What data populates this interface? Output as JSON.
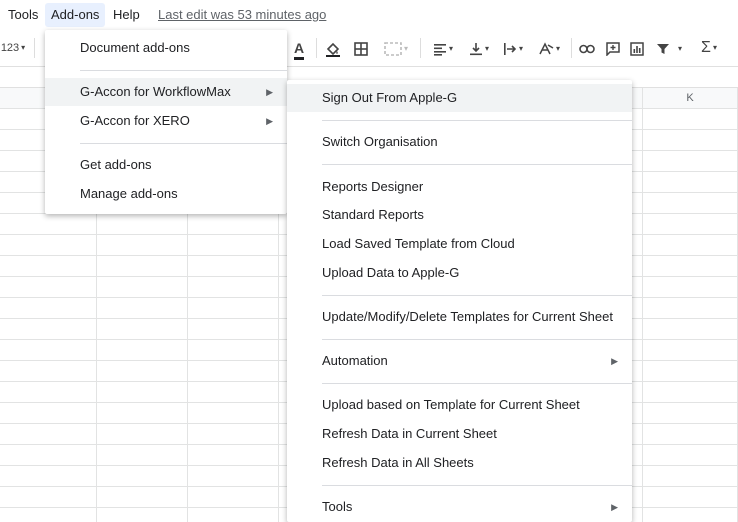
{
  "menubar": {
    "tools": "Tools",
    "addons": "Add-ons",
    "help": "Help",
    "last_edit": "Last edit was 53 minutes ago"
  },
  "toolbar": {
    "format_number": "123",
    "text_color_glyph": "A"
  },
  "columns": {
    "k": "K"
  },
  "addons_menu": {
    "document_addons": "Document add-ons",
    "gaccon_wfm": "G-Accon for WorkflowMax",
    "gaccon_xero": "G-Accon for XERO",
    "get_addons": "Get add-ons",
    "manage_addons": "Manage add-ons"
  },
  "submenu": {
    "sign_out": "Sign Out From Apple-G",
    "switch_org": "Switch Organisation",
    "reports_designer": "Reports Designer",
    "standard_reports": "Standard Reports",
    "load_template": "Load Saved Template from Cloud",
    "upload_data": "Upload Data to Apple-G",
    "update_templates": "Update/Modify/Delete Templates for Current Sheet",
    "automation": "Automation",
    "upload_based": "Upload based on Template for Current Sheet",
    "refresh_current": "Refresh Data in Current Sheet",
    "refresh_all": "Refresh Data in All Sheets",
    "tools": "Tools"
  },
  "icons": {
    "arrow": "▶"
  }
}
